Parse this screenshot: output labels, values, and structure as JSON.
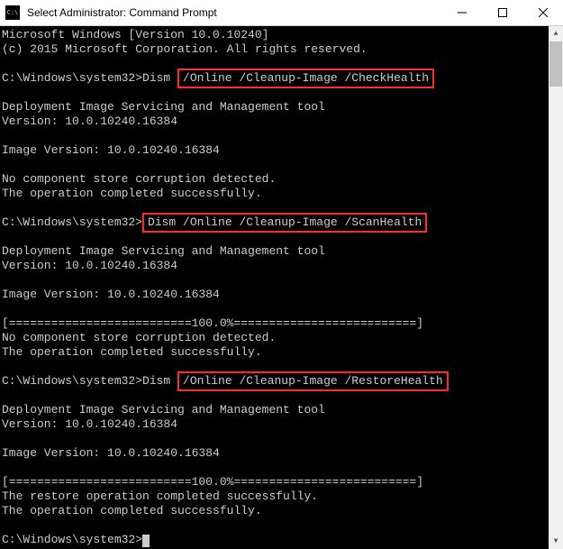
{
  "titlebar": {
    "title": "Select Administrator: Command Prompt"
  },
  "terminal": {
    "line_ms1": "Microsoft Windows [Version 10.0.10240]",
    "line_ms2": "(c) 2015 Microsoft Corporation. All rights reserved.",
    "prompt1_prefix": "C:\\Windows\\system32>Dism ",
    "prompt1_hl": "/Online /Cleanup-Image /CheckHealth",
    "dism_heading": "Deployment Image Servicing and Management tool",
    "dism_version": "Version: 10.0.10240.16384",
    "img_version": "Image Version: 10.0.10240.16384",
    "no_corrupt": "No component store corruption detected.",
    "op_success": "The operation completed successfully.",
    "prompt2_prefix": "C:\\Windows\\system32>",
    "prompt2_hl": "Dism /Online /Cleanup-Image /ScanHealth",
    "progress": "[==========================100.0%==========================]",
    "prompt3_prefix": "C:\\Windows\\system32>Dism ",
    "prompt3_hl": "/Online /Cleanup-Image /RestoreHealth",
    "restore_success": "The restore operation completed successfully.",
    "final_prompt": "C:\\Windows\\system32>"
  }
}
